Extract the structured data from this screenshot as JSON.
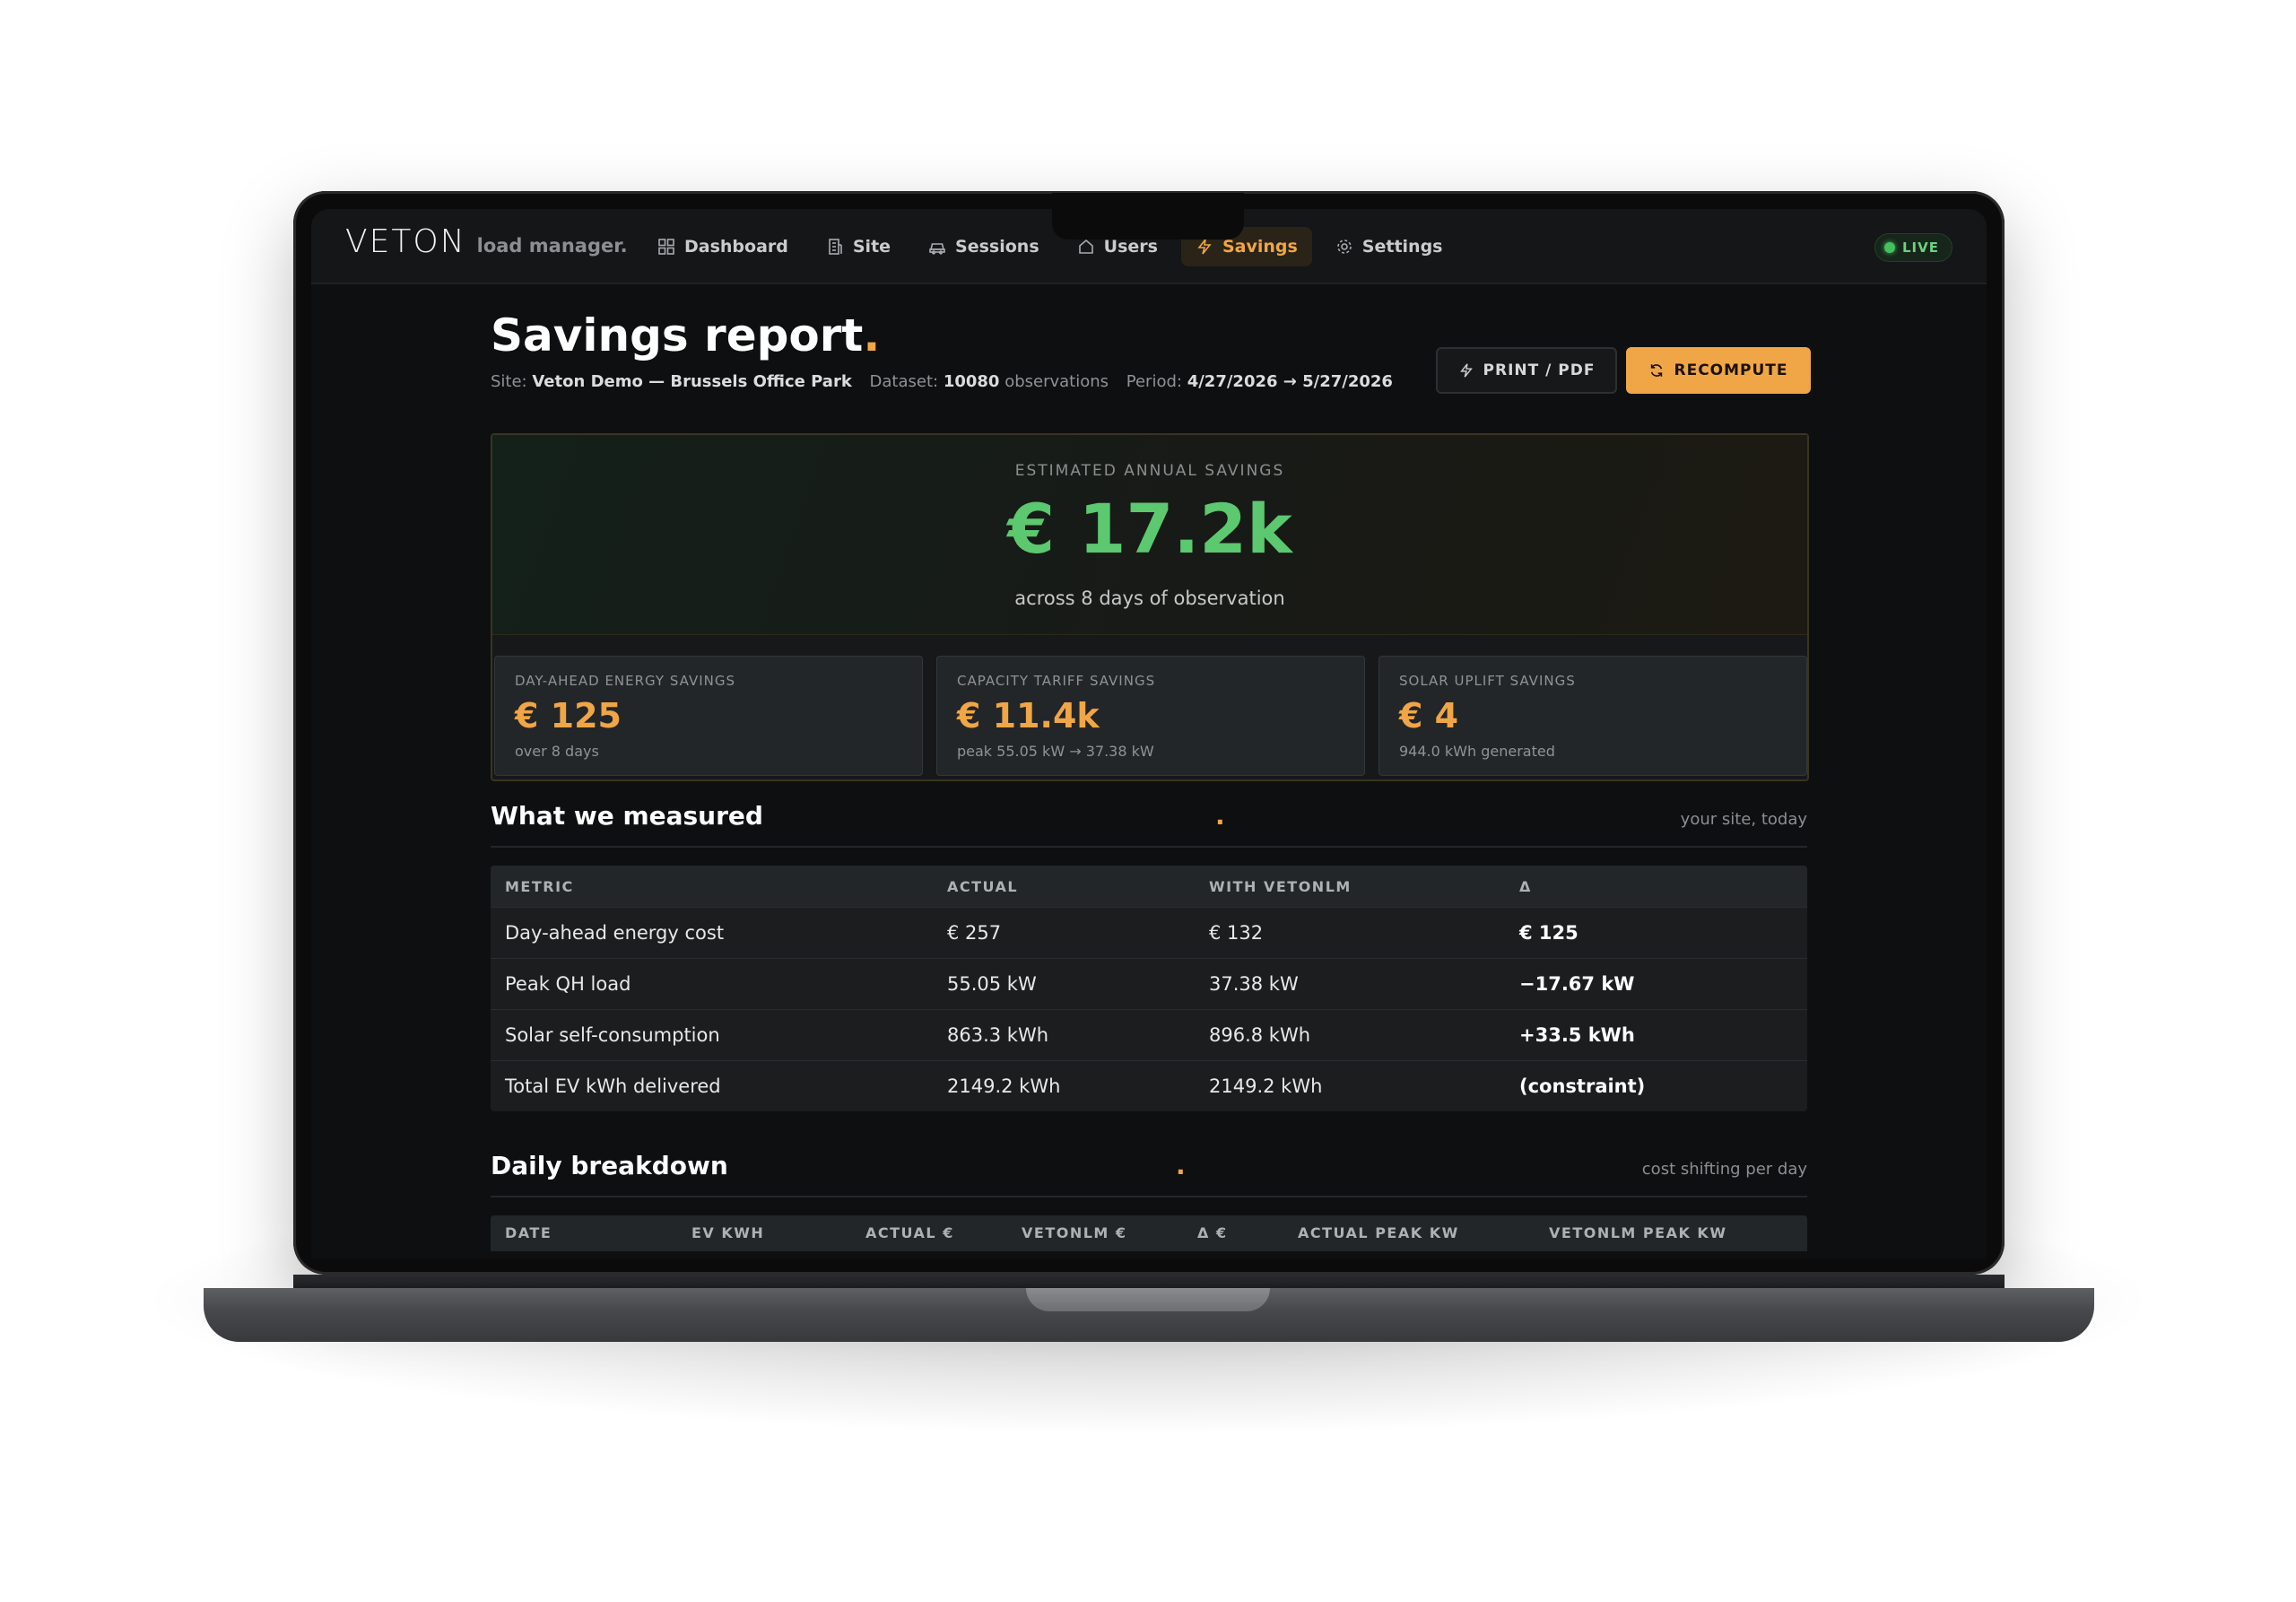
{
  "app": {
    "logo": "VETON",
    "logo_sub": "load manager.",
    "live_label": "LIVE"
  },
  "nav": {
    "items": [
      {
        "label": "Dashboard",
        "icon": "grid-icon"
      },
      {
        "label": "Site",
        "icon": "building-icon"
      },
      {
        "label": "Sessions",
        "icon": "car-icon"
      },
      {
        "label": "Users",
        "icon": "home-icon"
      },
      {
        "label": "Savings",
        "icon": "bolt-icon",
        "active": true
      },
      {
        "label": "Settings",
        "icon": "gear-icon"
      }
    ]
  },
  "header": {
    "title": "Savings report",
    "title_dot": ".",
    "site_label": "Site:",
    "site_value": "Veton Demo — Brussels Office Park",
    "dataset_label": "Dataset:",
    "dataset_value": "10080",
    "dataset_unit": "observations",
    "period_label": "Period:",
    "period_value": "4/27/2026 → 5/27/2026",
    "print_label": "PRINT / PDF",
    "recompute_label": "RECOMPUTE"
  },
  "hero": {
    "label": "ESTIMATED ANNUAL SAVINGS",
    "value": "€ 17.2k",
    "sub": "across 8 days of observation",
    "tiles": [
      {
        "label": "DAY-AHEAD ENERGY SAVINGS",
        "value": "€ 125",
        "note": "over 8 days"
      },
      {
        "label": "CAPACITY TARIFF SAVINGS",
        "value": "€ 11.4k",
        "note": "peak 55.05 kW → 37.38 kW"
      },
      {
        "label": "SOLAR UPLIFT SAVINGS",
        "value": "€ 4",
        "note": "944.0 kWh generated"
      }
    ]
  },
  "measured": {
    "title": "What we measured",
    "dot": ".",
    "note": "your site, today",
    "columns": [
      "METRIC",
      "ACTUAL",
      "WITH VETONLM",
      "Δ"
    ],
    "rows": [
      [
        "Day-ahead energy cost",
        "€ 257",
        "€ 132",
        "€ 125"
      ],
      [
        "Peak QH load",
        "55.05 kW",
        "37.38 kW",
        "−17.67 kW"
      ],
      [
        "Solar self-consumption",
        "863.3 kWh",
        "896.8 kWh",
        "+33.5 kWh"
      ],
      [
        "Total EV kWh delivered",
        "2149.2 kWh",
        "2149.2 kWh",
        "(constraint)"
      ]
    ]
  },
  "daily": {
    "title": "Daily breakdown",
    "dot": ".",
    "note": "cost shifting per day",
    "columns": [
      "DATE",
      "EV KWH",
      "ACTUAL €",
      "VETONLM €",
      "Δ €",
      "ACTUAL PEAK KW",
      "VETONLM PEAK KW"
    ]
  },
  "colors": {
    "accent": "#f0a646",
    "positive": "#5cc86f",
    "background": "#0d0f10"
  }
}
